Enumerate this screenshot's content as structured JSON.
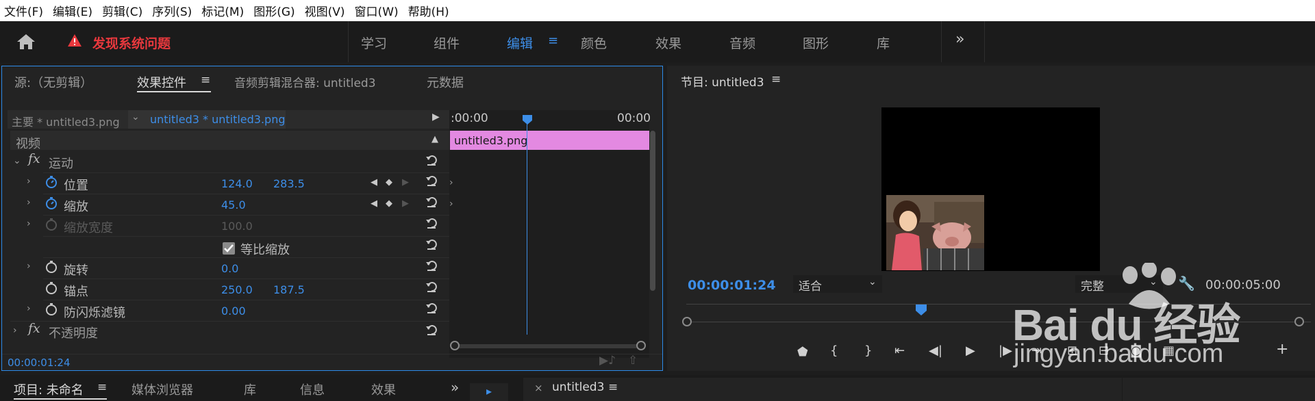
{
  "menu": [
    "文件(F)",
    "编辑(E)",
    "剪辑(C)",
    "序列(S)",
    "标记(M)",
    "图形(G)",
    "视图(V)",
    "窗口(W)",
    "帮助(H)"
  ],
  "header": {
    "alert": "发现系统问题",
    "tabs": [
      "学习",
      "组件",
      "编辑",
      "颜色",
      "效果",
      "音频",
      "图形",
      "库"
    ],
    "active_tab": "编辑",
    "more": "»"
  },
  "left_panel": {
    "tabs": {
      "source": "源:（无剪辑）",
      "effect_controls": "效果控件",
      "audio_mixer": "音频剪辑混合器: untitled3",
      "metadata": "元数据"
    },
    "clip_selector": {
      "master": "主要 * untitled3.png",
      "sequence": "untitled3 * untitled3.png"
    },
    "timeline": {
      "start": ":00:00",
      "end": "00:00",
      "clip_name": "untitled3.png"
    },
    "section_video": "视频",
    "effects": {
      "motion": "运动",
      "position": {
        "label": "位置",
        "x": "124.0",
        "y": "283.5"
      },
      "scale": {
        "label": "缩放",
        "value": "45.0"
      },
      "scale_width": {
        "label": "缩放宽度",
        "value": "100.0"
      },
      "uniform_scale": "等比缩放",
      "rotation": {
        "label": "旋转",
        "value": "0.0"
      },
      "anchor": {
        "label": "锚点",
        "x": "250.0",
        "y": "187.5"
      },
      "flicker": {
        "label": "防闪烁滤镜",
        "value": "0.00"
      },
      "opacity": "不透明度"
    },
    "timecode": "00:00:01:24",
    "fx_label": "fx"
  },
  "program": {
    "title": "节目: untitled3",
    "timecode": "00:00:01:24",
    "fit": "适合",
    "quality": "完整",
    "duration": "00:00:05:00"
  },
  "bottom": {
    "tabs": [
      "项目: 未命名",
      "媒体浏览器",
      "库",
      "信息",
      "效果"
    ],
    "more": "»",
    "timeline_tab": "untitled3",
    "close": "×"
  },
  "watermark": {
    "brand": "Bai du 经验",
    "url": "jingyan.baidu.com"
  }
}
